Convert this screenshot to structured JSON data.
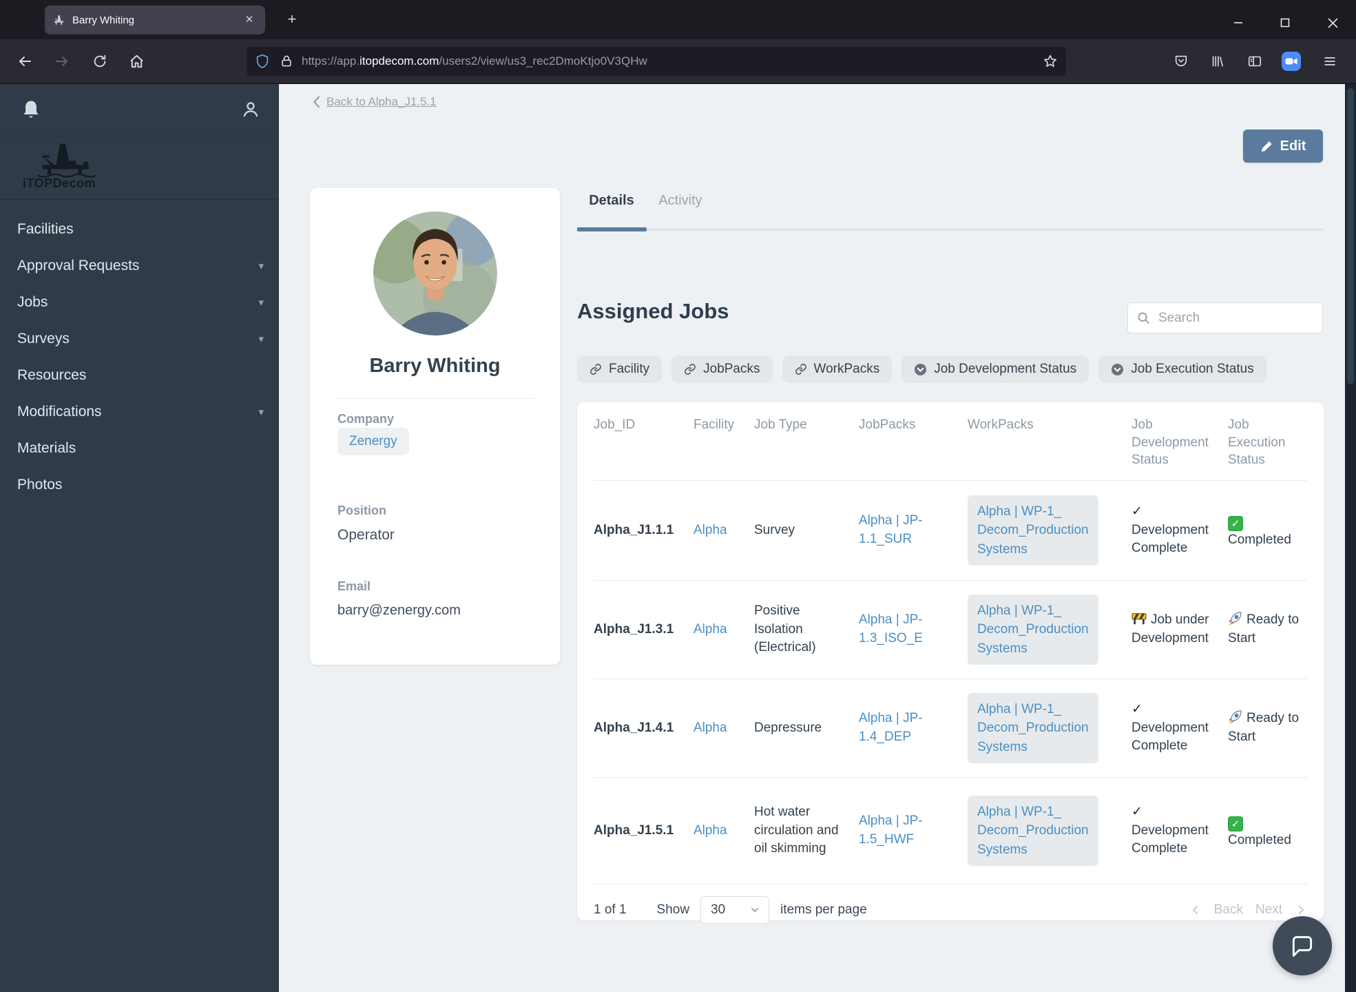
{
  "browser": {
    "tab": {
      "title": "Barry Whiting"
    },
    "address": {
      "prefix": "https://app.",
      "domain": "itopdecom.com",
      "path": "/users2/view/us3_rec2DmoKtjo0V3QHw"
    }
  },
  "sidebar": {
    "logo_text": "iTOPDecom",
    "items": [
      {
        "label": "Facilities",
        "has_submenu": false
      },
      {
        "label": "Approval Requests",
        "has_submenu": true
      },
      {
        "label": "Jobs",
        "has_submenu": true
      },
      {
        "label": "Surveys",
        "has_submenu": true
      },
      {
        "label": "Resources",
        "has_submenu": false
      },
      {
        "label": "Modifications",
        "has_submenu": true
      },
      {
        "label": "Materials",
        "has_submenu": false
      },
      {
        "label": "Photos",
        "has_submenu": false
      }
    ],
    "submenu_chevron": "▾"
  },
  "page": {
    "back_link_label": "Back to Alpha_J1.5.1",
    "edit_label": "Edit",
    "tabs": [
      {
        "label": "Details",
        "active": true
      },
      {
        "label": "Activity",
        "active": false
      }
    ],
    "profile": {
      "name": "Barry Whiting",
      "company_label": "Company",
      "company_value": "Zenergy",
      "position_label": "Position",
      "position_value": "Operator",
      "email_label": "Email",
      "email_value": "barry@zenergy.com"
    },
    "jobs": {
      "title": "Assigned Jobs",
      "search_placeholder": "Search",
      "filters": [
        {
          "label": "Facility",
          "icon": "link-icon"
        },
        {
          "label": "JobPacks",
          "icon": "link-icon"
        },
        {
          "label": "WorkPacks",
          "icon": "link-icon"
        },
        {
          "label": "Job Development Status",
          "icon": "circle-chevron-icon"
        },
        {
          "label": "Job Execution Status",
          "icon": "circle-chevron-icon"
        }
      ],
      "table": {
        "columns": [
          "Job_ID",
          "Facility",
          "Job Type",
          "JobPacks",
          "WorkPacks",
          "Job Development Status",
          "Job Execution Status"
        ],
        "rows": [
          {
            "job_id": "Alpha_J1.1.1",
            "facility": "Alpha",
            "job_type": "Survey",
            "jobpacks": "Alpha | JP-1.1_SUR",
            "workpacks_lines": [
              "Alpha | WP-1_",
              "Decom_Production",
              "Systems"
            ],
            "dev_status": {
              "icon": "check-icon",
              "label": "Development Complete"
            },
            "exec_status": {
              "icon": "green-checkbox-icon",
              "label": "Completed"
            }
          },
          {
            "job_id": "Alpha_J1.3.1",
            "facility": "Alpha",
            "job_type": "Positive Isolation (Electrical)",
            "jobpacks": "Alpha | JP-1.3_ISO_E",
            "workpacks_lines": [
              "Alpha | WP-1_",
              "Decom_Production",
              "Systems"
            ],
            "dev_status": {
              "icon": "barrier-icon",
              "label": "Job under Development"
            },
            "exec_status": {
              "icon": "rocket-icon",
              "label": "Ready to Start"
            }
          },
          {
            "job_id": "Alpha_J1.4.1",
            "facility": "Alpha",
            "job_type": "Depressure",
            "jobpacks": "Alpha | JP-1.4_DEP",
            "workpacks_lines": [
              "Alpha | WP-1_",
              "Decom_Production",
              "Systems"
            ],
            "dev_status": {
              "icon": "check-icon",
              "label": "Development Complete"
            },
            "exec_status": {
              "icon": "rocket-icon",
              "label": "Ready to Start"
            }
          },
          {
            "job_id": "Alpha_J1.5.1",
            "facility": "Alpha",
            "job_type": "Hot water circulation and oil skimming",
            "jobpacks": "Alpha | JP-1.5_HWF",
            "workpacks_lines": [
              "Alpha | WP-1_",
              "Decom_Production",
              "Systems"
            ],
            "dev_status": {
              "icon": "check-icon",
              "label": "Development Complete"
            },
            "exec_status": {
              "icon": "green-checkbox-icon",
              "label": "Completed"
            }
          }
        ]
      },
      "pagination": {
        "page_info": "1 of 1",
        "show_label": "Show",
        "page_size": "30",
        "items_label": "items per page",
        "back_label": "Back",
        "next_label": "Next"
      }
    }
  },
  "colors": {
    "accent": "#5a7b9e",
    "link_blue": "#4a8fc4",
    "sidebar_bg": "#303b49",
    "content_bg": "#eef1f4",
    "status_green": "#35b34a"
  }
}
